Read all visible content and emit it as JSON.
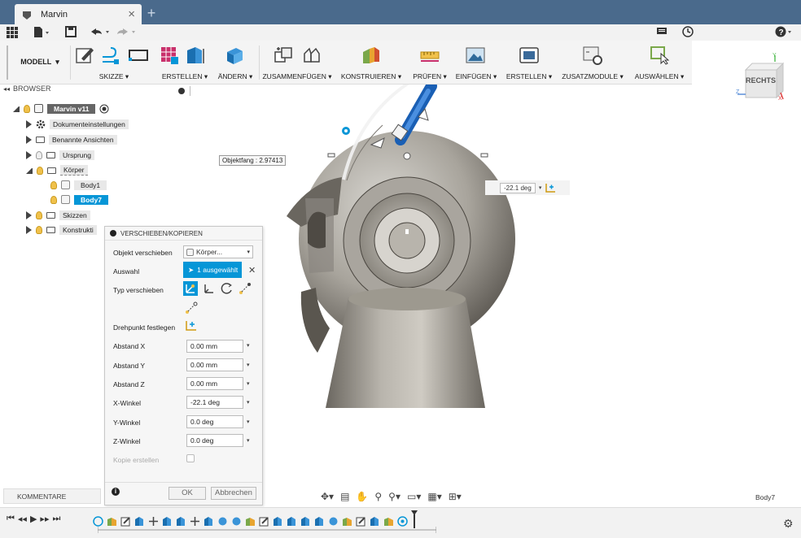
{
  "app": {
    "tab_title": "Marvin",
    "new_tab": "+",
    "close": "×"
  },
  "ribbon": {
    "workspace": "MODELL",
    "groups": [
      "SKIZZE",
      "ERSTELLEN",
      "ÄNDERN",
      "ZUSAMMENFÜGEN",
      "KONSTRUIEREN",
      "PRÜFEN",
      "EINFÜGEN",
      "ERSTELLEN",
      "ZUSATZMODULE",
      "AUSWÄHLEN"
    ]
  },
  "viewcube": {
    "face": "RECHTS",
    "axis_y": "Y",
    "axis_z": "Z",
    "axis_x": "X"
  },
  "browser": {
    "header": "BROWSER",
    "items": [
      {
        "label": "Marvin v11"
      },
      {
        "label": "Dokumenteinstellungen"
      },
      {
        "label": "Benannte Ansichten"
      },
      {
        "label": "Ursprung"
      },
      {
        "label": "Körper"
      },
      {
        "label": "Body1"
      },
      {
        "label": "Body7"
      },
      {
        "label": "Skizzen"
      },
      {
        "label": "Konstrukti"
      }
    ]
  },
  "viewport": {
    "snap_label": "Objektfang : 2.97413",
    "angle_value": "-22.1 deg"
  },
  "panel": {
    "title": "VERSCHIEBEN/KOPIEREN",
    "rows": {
      "objekt_label": "Objekt verschieben",
      "objekt_value": "Körper...",
      "auswahl_label": "Auswahl",
      "auswahl_value": "1 ausgewählt",
      "typ_label": "Typ verschieben",
      "drehpunkt_label": "Drehpunkt festlegen",
      "ax_label": "Abstand X",
      "ax_value": "0.00 mm",
      "ay_label": "Abstand Y",
      "ay_value": "0.00 mm",
      "az_label": "Abstand Z",
      "az_value": "0.00 mm",
      "xw_label": "X-Winkel",
      "xw_value": "-22.1 deg",
      "yw_label": "Y-Winkel",
      "yw_value": "0.0 deg",
      "zw_label": "Z-Winkel",
      "zw_value": "0.0 deg",
      "kopie_label": "Kopie erstellen"
    },
    "ok": "OK",
    "cancel": "Abbrechen"
  },
  "status": {
    "comments": "KOMMENTARE",
    "selection": "Body7"
  },
  "colors": {
    "titlebar": "#4a6a8c",
    "accent": "#0696d7",
    "selected": "#0696d7"
  }
}
